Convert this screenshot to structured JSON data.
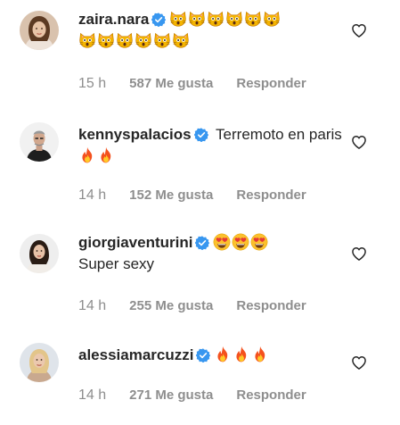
{
  "comments": [
    {
      "username": "zaira.nara",
      "verified_icon": "verified-badge-icon",
      "text": "",
      "emojis": [
        "cat-face-icon",
        "cat-face-icon",
        "cat-face-icon",
        "cat-face-icon",
        "cat-face-icon",
        "cat-face-icon",
        "cat-face-icon",
        "cat-face-icon",
        "cat-face-icon",
        "cat-face-icon",
        "cat-face-icon",
        "cat-face-icon"
      ],
      "time": "15 h",
      "likes": "587 Me gusta",
      "reply_label": "Responder"
    },
    {
      "username": "kennyspalacios",
      "verified_icon": "verified-badge-icon",
      "text": "Terremoto en paris",
      "emojis": [
        "fire-icon",
        "fire-icon"
      ],
      "time": "14 h",
      "likes": "152 Me gusta",
      "reply_label": "Responder"
    },
    {
      "username": "giorgiaventurini",
      "verified_icon": "verified-badge-icon",
      "text": "Super sexy",
      "emojis": [
        "heart-eyes-face-icon",
        "heart-eyes-face-icon",
        "heart-eyes-face-icon"
      ],
      "time": "14 h",
      "likes": "255 Me gusta",
      "reply_label": "Responder"
    },
    {
      "username": "alessiamarcuzzi",
      "verified_icon": "verified-badge-icon",
      "text": "",
      "emojis": [
        "fire-icon",
        "fire-icon",
        "fire-icon"
      ],
      "time": "14 h",
      "likes": "271 Me gusta",
      "reply_label": "Responder"
    }
  ],
  "colors": {
    "text": "#262626",
    "meta": "#8e8e8e",
    "verified": "#3897f0",
    "heart_outline": "#8e8e8e"
  }
}
